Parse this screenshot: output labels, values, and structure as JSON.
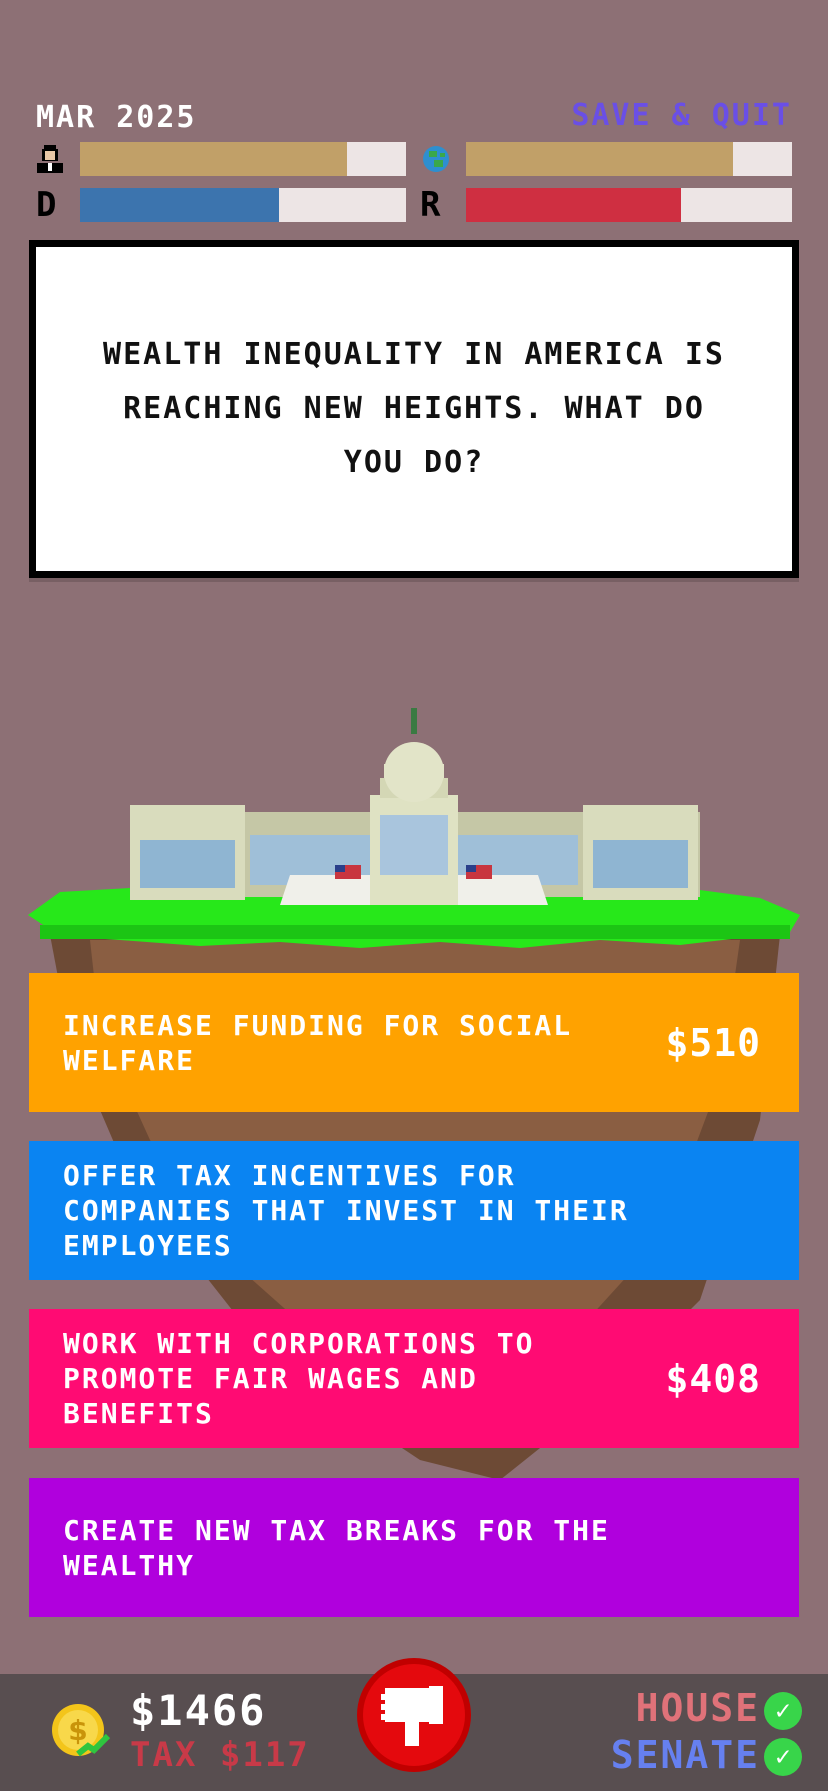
{
  "header": {
    "date": "MAR 2025",
    "save_quit": "SAVE & QUIT",
    "meters": {
      "approval_icon": "person-icon",
      "approval_level": 0.82,
      "approval_color": "#c1a068",
      "world_icon": "globe-icon",
      "world_level": 0.82,
      "world_color": "#c1a068",
      "democrat_label": "D",
      "democrat_level": 0.61,
      "democrat_color": "#3c74ae",
      "republican_label": "R",
      "republican_level": 0.66,
      "republican_color": "#cf2f41",
      "empty_color": "#ede5e5"
    }
  },
  "prompt": {
    "text": "WEALTH INEQUALITY IN AMERICA IS REACHING NEW HEIGHTS. WHAT DO YOU DO?"
  },
  "options": [
    {
      "text": "INCREASE FUNDING FOR SOCIAL WELFARE",
      "cost": "$510",
      "color": "#ffa200"
    },
    {
      "text": "OFFER TAX INCENTIVES FOR COMPANIES THAT INVEST IN THEIR EMPLOYEES",
      "cost": "",
      "color": "#0a84f2"
    },
    {
      "text": "WORK WITH CORPORATIONS TO PROMOTE FAIR WAGES AND BENEFITS",
      "cost": "$408",
      "color": "#ff0b73"
    },
    {
      "text": "CREATE NEW TAX BREAKS FOR THE WEALTHY",
      "cost": "",
      "color": "#b000dd"
    }
  ],
  "footer": {
    "coin_icon": "coin-icon",
    "money": "$1466",
    "tax": "TAX $117",
    "veto_icon": "thumbs-down-icon",
    "house_label": "HOUSE",
    "senate_label": "SENATE",
    "check_icon": "check-icon"
  }
}
